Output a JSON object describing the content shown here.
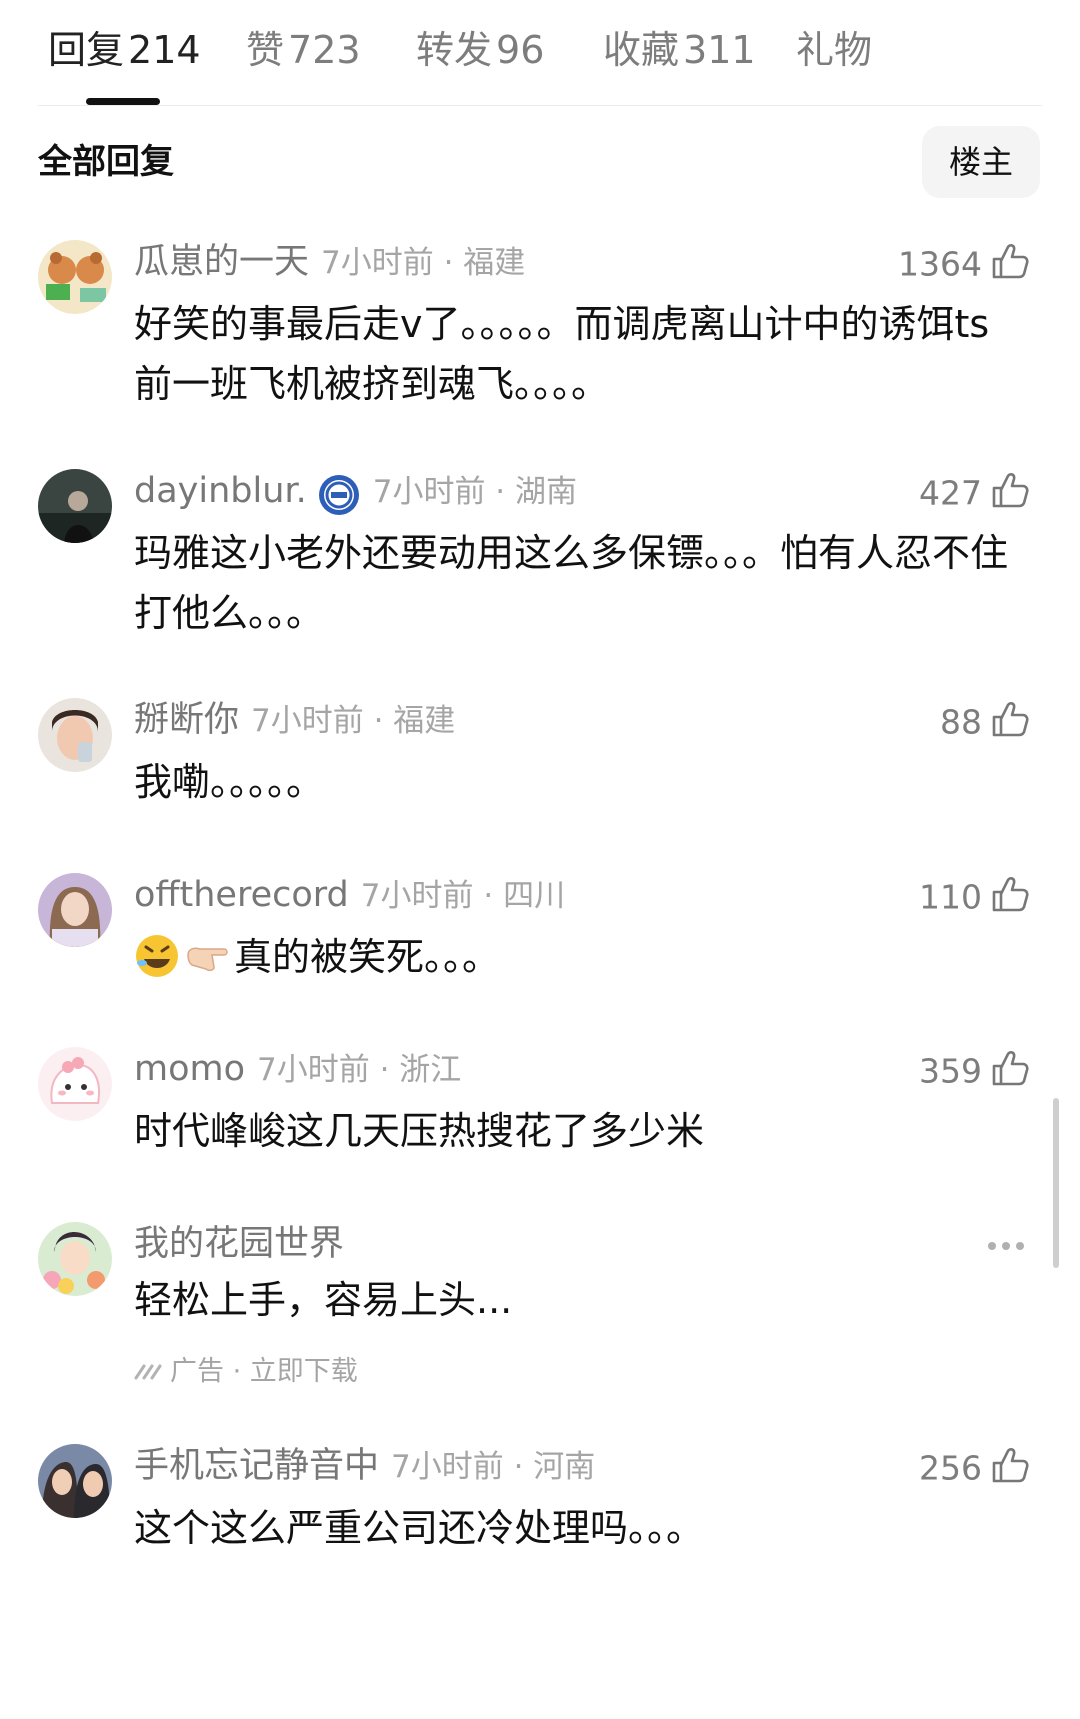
{
  "tabs": [
    {
      "label": "回复",
      "count": "214"
    },
    {
      "label": "赞",
      "count": "723"
    },
    {
      "label": "转发",
      "count": "96"
    },
    {
      "label": "收藏",
      "count": "311"
    },
    {
      "label": "礼物",
      "count": ""
    }
  ],
  "section": {
    "title": "全部回复",
    "owner_button": "楼主"
  },
  "comments": [
    {
      "username": "瓜崽的一天",
      "time_loc": "7小时前 · 福建",
      "likes": "1364",
      "text": "好笑的事最后走v了。。。。。而调虎离山计中的诱饵ts前一班飞机被挤到魂飞。。。。"
    },
    {
      "username": "dayinblur.",
      "time_loc": "7小时前 · 湖南",
      "likes": "427",
      "text": "玛雅这小老外还要动用这么多保镖。。。怕有人忍不住打他么。。。"
    },
    {
      "username": "掰断你",
      "time_loc": "7小时前 · 福建",
      "likes": "88",
      "text": "我嘞。。。。。"
    },
    {
      "username": "offtherecord",
      "time_loc": "7小时前 · 四川",
      "likes": "110",
      "text": "真的被笑死。。。",
      "emoji_icons": [
        "rolling-laughing-emoji",
        "pointing-hand-emoji"
      ]
    },
    {
      "username": "momo",
      "time_loc": "7小时前 · 浙江",
      "likes": "359",
      "text": "时代峰峻这几天压热搜花了多少米"
    },
    {
      "username": "手机忘记静音中",
      "time_loc": "7小时前 · 河南",
      "likes": "256",
      "text": "这个这么严重公司还冷处理吗。。。"
    }
  ],
  "ad": {
    "username": "我的花园世界",
    "text": "轻松上手，容易上头...",
    "label": "广告 · 立即下载"
  },
  "colors": {
    "text": "#111111",
    "secondary": "#7d7d7d",
    "tertiary": "#a5a5a5",
    "divider": "#ececec",
    "button_bg": "#f4f4f4"
  }
}
